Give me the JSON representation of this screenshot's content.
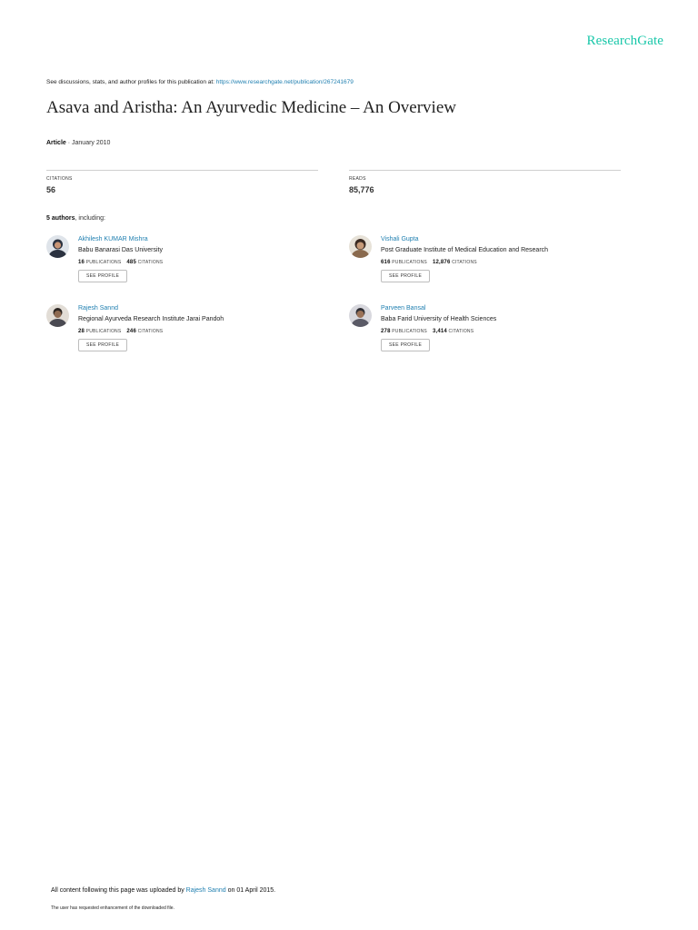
{
  "brand": "ResearchGate",
  "topline": {
    "prefix": "See discussions, stats, and author profiles for this publication at: ",
    "url": "https://www.researchgate.net/publication/267241679"
  },
  "title": "Asava and Aristha: An Ayurvedic Medicine – An Overview",
  "meta": {
    "type": "Article",
    "date": "· January 2010"
  },
  "stats": {
    "citations": {
      "label": "CITATIONS",
      "value": "56"
    },
    "reads": {
      "label": "READS",
      "value": "85,776"
    }
  },
  "authors_heading": {
    "count": "5 authors",
    "suffix": ", including:"
  },
  "authors": [
    {
      "name": "Akhilesh KUMAR Mishra",
      "institution": "Babu Banarasi Das University",
      "publications": "16",
      "citations": "485",
      "button": "SEE PROFILE",
      "avatar_color": "#2b3240"
    },
    {
      "name": "Vishali Gupta",
      "institution": "Post Graduate Institute of Medical Education and Research",
      "publications": "616",
      "citations": "12,876",
      "button": "SEE PROFILE",
      "avatar_color": "#7a5a44"
    },
    {
      "name": "Rajesh Sannd",
      "institution": "Regional Ayurveda Research Institute Jarai Pandoh",
      "publications": "28",
      "citations": "246",
      "button": "SEE PROFILE",
      "avatar_color": "#5a4a3a"
    },
    {
      "name": "Parveen Bansal",
      "institution": "Baba Farid University of Health Sciences",
      "publications": "278",
      "citations": "3,414",
      "button": "SEE PROFILE",
      "avatar_color": "#6c6c78"
    }
  ],
  "labels": {
    "publications": "PUBLICATIONS",
    "citations": "CITATIONS"
  },
  "footer": {
    "prefix": "All content following this page was uploaded by ",
    "uploader": "Rajesh Sannd",
    "suffix": " on 01 April 2015.",
    "note": "The user has requested enhancement of the downloaded file."
  }
}
